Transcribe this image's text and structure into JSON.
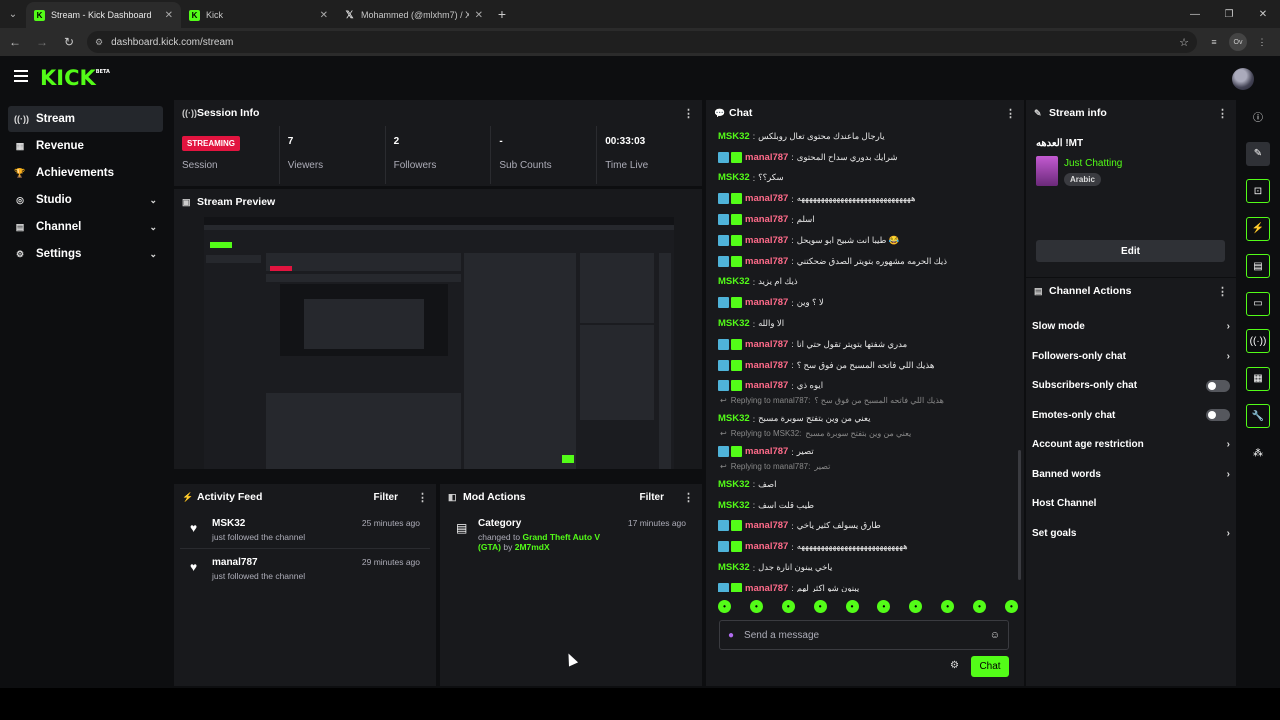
{
  "browser": {
    "tabs": [
      {
        "title": "Stream - Kick Dashboard",
        "favicon": "K",
        "active": true
      },
      {
        "title": "Kick",
        "favicon": "K",
        "active": false
      },
      {
        "title": "Mohammed (@mlxhm7) / X",
        "favicon": "𝕏",
        "active": false
      }
    ],
    "url": "dashboard.kick.com/stream",
    "profile": "Ov"
  },
  "app": {
    "logo": "KICK",
    "logo_sup": "BETA"
  },
  "sidebar": {
    "items": [
      {
        "label": "Stream",
        "icon": "stream-icon",
        "active": true,
        "chevron": false
      },
      {
        "label": "Revenue",
        "icon": "revenue-icon",
        "active": false,
        "chevron": false
      },
      {
        "label": "Achievements",
        "icon": "trophy-icon",
        "active": false,
        "chevron": false
      },
      {
        "label": "Studio",
        "icon": "studio-icon",
        "active": false,
        "chevron": true
      },
      {
        "label": "Channel",
        "icon": "channel-icon",
        "active": false,
        "chevron": true
      },
      {
        "label": "Settings",
        "icon": "gear-icon",
        "active": false,
        "chevron": true
      }
    ]
  },
  "session": {
    "title": "Session Info",
    "status": "STREAMING",
    "cells": [
      {
        "value": "",
        "label": "Session"
      },
      {
        "value": "7",
        "label": "Viewers"
      },
      {
        "value": "2",
        "label": "Followers"
      },
      {
        "value": "-",
        "label": "Sub Counts"
      },
      {
        "value": "00:33:03",
        "label": "Time Live"
      }
    ]
  },
  "preview": {
    "title": "Stream Preview"
  },
  "activity": {
    "title": "Activity Feed",
    "filter": "Filter",
    "items": [
      {
        "name": "MSK32",
        "desc": "just followed the channel",
        "time": "25 minutes ago"
      },
      {
        "name": "manal787",
        "desc": "just followed the channel",
        "time": "29 minutes ago"
      }
    ]
  },
  "mod": {
    "title": "Mod Actions",
    "filter": "Filter",
    "item": {
      "name": "Category",
      "prefix": "changed to",
      "game": "Grand Theft Auto V (GTA)",
      "by": "by",
      "user": "2M7mdX",
      "time": "17 minutes ago"
    }
  },
  "chat": {
    "title": "Chat",
    "messages": [
      {
        "type": "msg",
        "user": "MSK32",
        "color": "green",
        "badges": false,
        "text": "يارجال ماعندك محتوى تعال روبلكس"
      },
      {
        "type": "msg",
        "user": "manal787",
        "color": "pink",
        "badges": true,
        "text": "شرايك بدوري سداح المحتوى"
      },
      {
        "type": "msg",
        "user": "MSK32",
        "color": "green",
        "badges": false,
        "text": "سكر؟؟"
      },
      {
        "type": "msg",
        "user": "manal787",
        "color": "pink",
        "badges": true,
        "text": "هههههههههههههههههههههههههههههه"
      },
      {
        "type": "msg",
        "user": "manal787",
        "color": "pink",
        "badges": true,
        "text": "اسلم"
      },
      {
        "type": "msg",
        "user": "manal787",
        "color": "pink",
        "badges": true,
        "text": "طيبا انت شبيح ابو سويحل 😂"
      },
      {
        "type": "msg",
        "user": "manal787",
        "color": "pink",
        "badges": true,
        "text": "ذيك الحرمه مشهوره بتويتر الصدق ضحكتني"
      },
      {
        "type": "msg",
        "user": "MSK32",
        "color": "green",
        "badges": false,
        "text": "ذيك ام يزيد"
      },
      {
        "type": "msg",
        "user": "manal787",
        "color": "pink",
        "badges": true,
        "text": "لا ؟ وين"
      },
      {
        "type": "msg",
        "user": "MSK32",
        "color": "green",
        "badges": false,
        "text": "الا والله"
      },
      {
        "type": "msg",
        "user": "manal787",
        "color": "pink",
        "badges": true,
        "text": "مدري شفتها بتويتر تقول حتي انا"
      },
      {
        "type": "msg",
        "user": "manal787",
        "color": "pink",
        "badges": true,
        "text": "هذيك اللي فاتحه المسبح من فوق سح ؟"
      },
      {
        "type": "msg",
        "user": "manal787",
        "color": "pink",
        "badges": true,
        "text": "ايوه ذي"
      },
      {
        "type": "reply",
        "to": "Replying to manal787:",
        "text": "هذيك اللي فاتحه المسبح من فوق سح ؟"
      },
      {
        "type": "msg",
        "user": "MSK32",
        "color": "green",
        "badges": false,
        "text": "يعني من وين بتفتح سوبرة مسبح"
      },
      {
        "type": "reply",
        "to": "Replying to MSK32:",
        "text": "يعني من وين بتفتح سوبرة مسبح"
      },
      {
        "type": "msg",
        "user": "manal787",
        "color": "pink",
        "badges": true,
        "text": "تصير"
      },
      {
        "type": "reply",
        "to": "Replying to manal787:",
        "text": "تصير"
      },
      {
        "type": "msg",
        "user": "MSK32",
        "color": "green",
        "badges": false,
        "text": "اصف"
      },
      {
        "type": "msg",
        "user": "MSK32",
        "color": "green",
        "badges": false,
        "text": "طيب قلت اسف"
      },
      {
        "type": "msg",
        "user": "manal787",
        "color": "pink",
        "badges": true,
        "text": "طارق يسولف كثير ياخي"
      },
      {
        "type": "msg",
        "user": "manal787",
        "color": "pink",
        "badges": true,
        "text": "هههههههههههههههههههههههههههه"
      },
      {
        "type": "msg",
        "user": "MSK32",
        "color": "green",
        "badges": false,
        "text": "ياخي يبنون انارة جدل"
      },
      {
        "type": "msg",
        "user": "manal787",
        "color": "pink",
        "badges": true,
        "text": "يبنون شو اكثر لهم"
      }
    ],
    "input_placeholder": "Send a message",
    "send_label": "Chat"
  },
  "stream_info": {
    "title": "Stream info",
    "stream_title": "العدهه !MT",
    "category": "Just Chatting",
    "tag": "Arabic",
    "edit_label": "Edit"
  },
  "channel_actions": {
    "title": "Channel Actions",
    "items": [
      {
        "label": "Slow mode",
        "control": "chevron"
      },
      {
        "label": "Followers-only chat",
        "control": "chevron"
      },
      {
        "label": "Subscribers-only chat",
        "control": "toggle"
      },
      {
        "label": "Emotes-only chat",
        "control": "toggle"
      },
      {
        "label": "Account age restriction",
        "control": "chevron"
      },
      {
        "label": "Banned words",
        "control": "chevron"
      },
      {
        "label": "Host Channel",
        "control": "none"
      },
      {
        "label": "Set goals",
        "control": "chevron"
      }
    ]
  },
  "rail": {
    "items": [
      "info-icon",
      "pencil-icon",
      "scan-icon",
      "bolt-icon",
      "clipboard-icon",
      "chat-bubble-icon",
      "broadcast-icon",
      "layout-icon",
      "wrench-icon",
      "palette-icon"
    ]
  },
  "colors": {
    "accent": "#53fc18",
    "live": "#e2143f",
    "panel": "#18191c",
    "bg": "#0d0e10"
  }
}
